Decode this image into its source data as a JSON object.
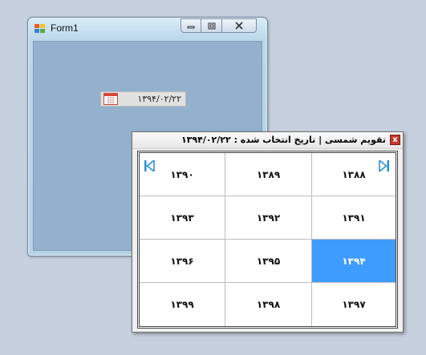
{
  "window": {
    "title": "Form1",
    "date_value": "۱۳۹۴/۰۲/۲۲"
  },
  "calendar": {
    "title_prefix": "تقویم شمسی | تاریخ انتخاب شده :",
    "title_date": "۱۳۹۴/۰۲/۲۲",
    "close_label": "x",
    "rows": [
      [
        "۱۳۹۰",
        "۱۳۸۹",
        "۱۳۸۸"
      ],
      [
        "۱۳۹۳",
        "۱۳۹۲",
        "۱۳۹۱"
      ],
      [
        "۱۳۹۶",
        "۱۳۹۵",
        "۱۳۹۴"
      ],
      [
        "۱۳۹۹",
        "۱۳۹۸",
        "۱۳۹۷"
      ]
    ],
    "selected": "۱۳۹۴"
  },
  "colors": {
    "selected_bg": "#3f9cff",
    "form_client": "#93b1cd",
    "nav_arrow": "#2a8fd6"
  },
  "icons": {
    "window_icon": "form-app-icon",
    "calendar_icon": "calendar-icon",
    "prev_nav": "skip-first-icon",
    "next_nav": "skip-last-icon"
  }
}
